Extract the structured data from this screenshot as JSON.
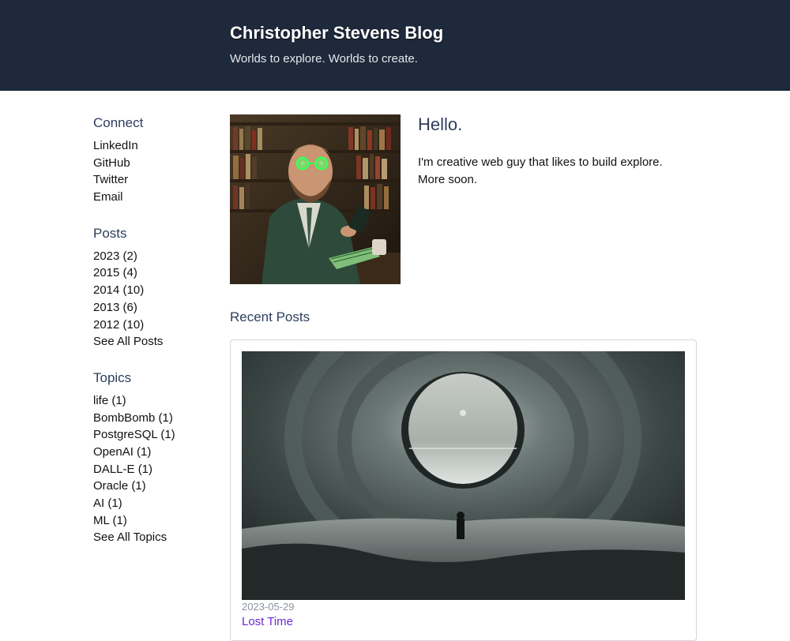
{
  "header": {
    "title": "Christopher Stevens Blog",
    "tagline": "Worlds to explore. Worlds to create."
  },
  "sidebar": {
    "connect": {
      "heading": "Connect",
      "items": [
        "LinkedIn",
        "GitHub",
        "Twitter",
        "Email"
      ]
    },
    "posts": {
      "heading": "Posts",
      "items": [
        "2023 (2)",
        "2015 (4)",
        "2014 (10)",
        "2013 (6)",
        "2012 (10)",
        "See All Posts"
      ]
    },
    "topics": {
      "heading": "Topics",
      "items": [
        "life (1)",
        "BombBomb (1)",
        "PostgreSQL (1)",
        "OpenAI (1)",
        "DALL-E (1)",
        "Oracle (1)",
        "AI (1)",
        "ML (1)",
        "See All Topics"
      ]
    }
  },
  "intro": {
    "heading": "Hello.",
    "text": "I'm creative web guy that likes to build explore. More soon."
  },
  "recent": {
    "heading": "Recent Posts",
    "posts": [
      {
        "date": "2023-05-29",
        "title": "Lost Time"
      }
    ]
  },
  "colors": {
    "header_bg": "#1e293b",
    "heading_text": "#2d3e5c",
    "post_link": "#6d28d9",
    "date_text": "#8a94a3"
  }
}
